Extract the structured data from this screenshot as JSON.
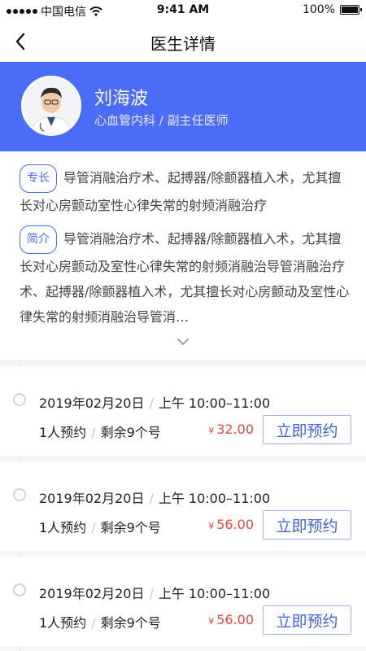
{
  "status_bar": {
    "carrier": "中国电信",
    "time": "9:41 AM",
    "battery_percent": "100%"
  },
  "nav": {
    "title": "医生详情",
    "back_icon": "chevron-left-icon"
  },
  "doctor": {
    "name": "刘海波",
    "meta": "心血管内科 / 副主任医师"
  },
  "specialty": {
    "tag": "专长",
    "text": "导管消融治疗术、起搏器/除颤器植入术，尤其擅长对心房颤动室性心律失常的射频消融治疗"
  },
  "intro": {
    "tag": "简介",
    "text": "导管消融治疗术、起搏器/除颤器植入术，尤其擅长对心房颤动及室性心律失常的射频消融治导管消融治疗术、起搏器/除颤器植入术，尤其擅长对心房颤动及室性心律失常的射频消融治导管消…"
  },
  "expand_icon": "chevron-down-icon",
  "colors": {
    "accent": "#4a6cf7",
    "price": "#e8463a"
  },
  "slots": [
    {
      "date": "2019年02月20日",
      "sep": "/",
      "time": "上午 10:00–11:00",
      "booked": "1人预约",
      "remaining": "剩余9个号",
      "currency": "¥",
      "price": "32.00",
      "button": "立即预约"
    },
    {
      "date": "2019年02月20日",
      "sep": "/",
      "time": "上午 10:00–11:00",
      "booked": "1人预约",
      "remaining": "剩余9个号",
      "currency": "¥",
      "price": "56.00",
      "button": "立即预约"
    },
    {
      "date": "2019年02月20日",
      "sep": "/",
      "time": "上午 10:00–11:00",
      "booked": "1人预约",
      "remaining": "剩余9个号",
      "currency": "¥",
      "price": "56.00",
      "button": "立即预约"
    }
  ]
}
